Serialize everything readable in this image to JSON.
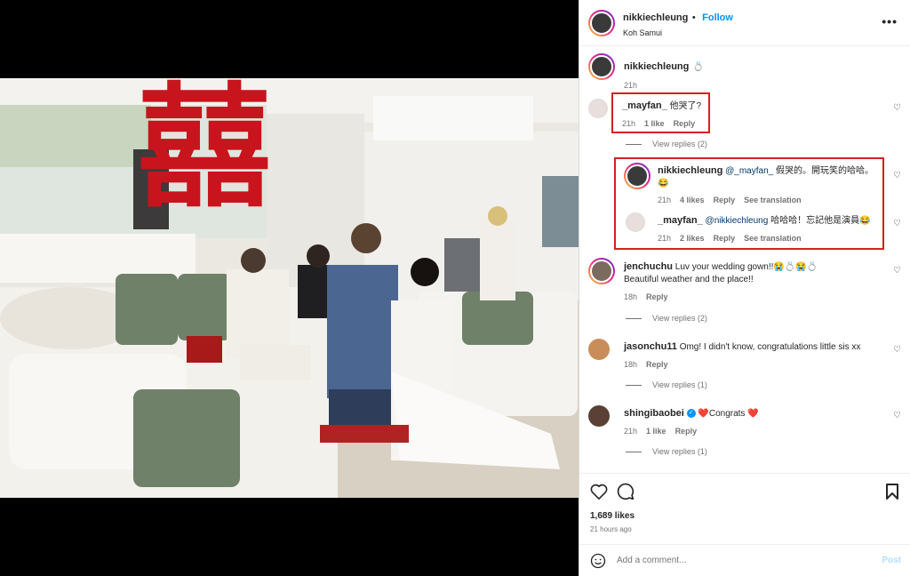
{
  "post": {
    "username": "nikkiechleung",
    "follow_label": "Follow",
    "location": "Koh Samui",
    "caption_emoji": "💍",
    "caption_time": "21h",
    "likes": "1,689 likes",
    "posted": "21 hours ago"
  },
  "wall_sign": "囍",
  "comments": [
    {
      "user": "_mayfan_",
      "text": "他哭了?",
      "time": "21h",
      "likes": "1 like",
      "reply": "Reply",
      "view": "View replies (2)"
    },
    {
      "user": "nikkiechleung",
      "mention": "@_mayfan_",
      "text": "假哭的。開玩笑的哈哈。",
      "text2": "😂",
      "time": "21h",
      "likes": "4 likes",
      "reply": "Reply",
      "translate": "See translation"
    },
    {
      "user": "_mayfan_",
      "mention": "@nikkiechleung",
      "text": "哈哈哈！忘記他是演員😂",
      "time": "21h",
      "likes": "2 likes",
      "reply": "Reply",
      "translate": "See translation"
    },
    {
      "user": "jenchuchu",
      "text": "Luv your wedding gown!!😭💍😭💍",
      "text2": "Beautiful weather and the place!!",
      "time": "18h",
      "reply": "Reply",
      "view": "View replies (2)"
    },
    {
      "user": "jasonchu11",
      "text": "Omg! I didn't know, congratulations little sis xx",
      "time": "18h",
      "reply": "Reply",
      "view": "View replies (1)"
    },
    {
      "user": "shingibaobei",
      "text": "❤️Congrats ❤️",
      "time": "21h",
      "likes": "1 like",
      "reply": "Reply",
      "view": "View replies (1)"
    }
  ],
  "add_comment": {
    "placeholder": "Add a comment...",
    "post_label": "Post"
  },
  "colors": {
    "link": "#0095f6",
    "highlight": "#d81f1f",
    "heart": "#e0245e"
  }
}
